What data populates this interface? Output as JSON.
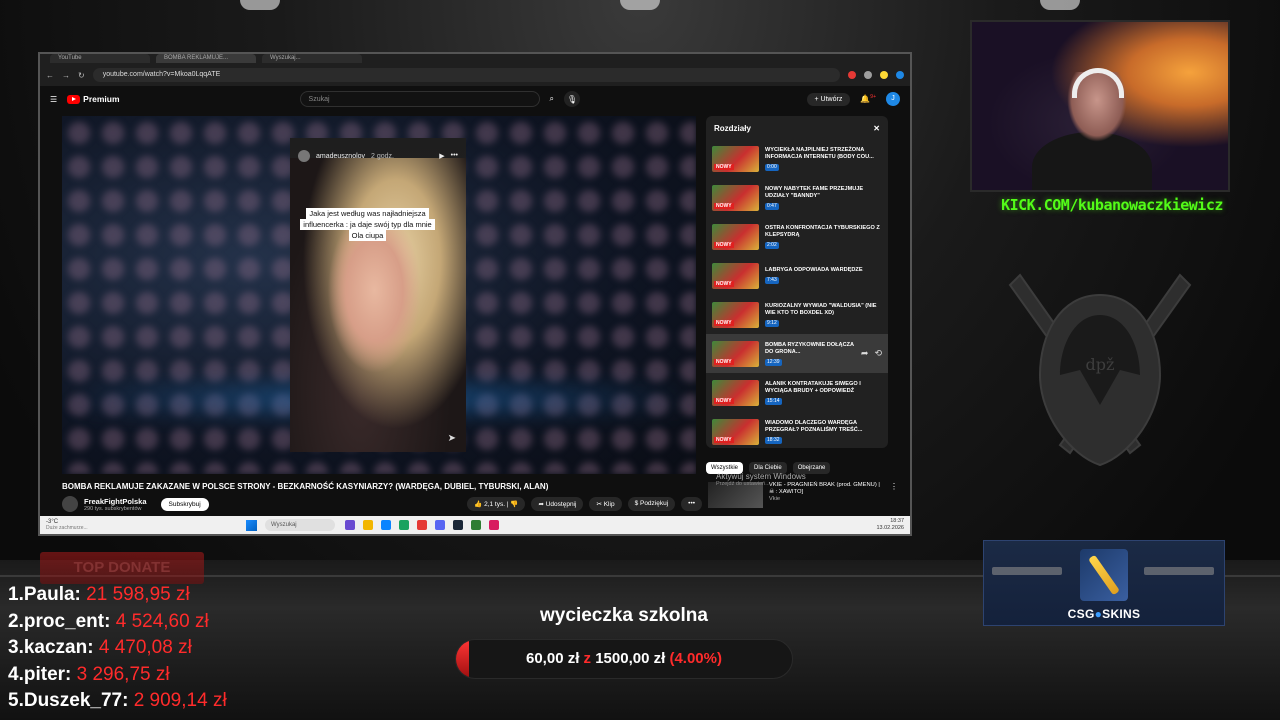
{
  "browser": {
    "tabs": [
      "YouTube",
      "BOMBA REKLAMUJE...",
      "Wyszukaj..."
    ],
    "url": "youtube.com/watch?v=Mkoa0LqqATE"
  },
  "youtube": {
    "logo": "Premium",
    "search_placeholder": "Szukaj",
    "create_label": "Utwórz",
    "notif_count": "9+",
    "avatar_initial": "J"
  },
  "instagram": {
    "username": "amadeusznolov",
    "time": "2 godz.",
    "caption": "Jaka jest według was najładniejsza influencerka : ja daje swój typ dla mnie Ola ciupa"
  },
  "chapters": {
    "title": "Rozdziały",
    "items": [
      {
        "title": "WYCIEKŁA NAJPILNIEJ STRZEŻONA INFORMACJA INTERNETU (BODY COU...",
        "time": "0:00"
      },
      {
        "title": "NOWY NABYTEK FAME PRZEJMUJE UDZIAŁY \"BANNDY\"",
        "time": "0:47"
      },
      {
        "title": "OSTRA KONFRONTACJA TYBURSKIEGO Z KLEPSYDRĄ",
        "time": "2:02"
      },
      {
        "title": "LABRYGA ODPOWIADA WARDĘDZE",
        "time": "7:43"
      },
      {
        "title": "KURIOZALNY WYWIAD \"WALDUSIA\" (NIE WIE KTO TO BOXDEL XD)",
        "time": "9:12"
      },
      {
        "title": "BOMBA RYZYKOWNIE DOŁĄCZA DO GRONA...",
        "time": "12:39"
      },
      {
        "title": "ALANIK KONTRATAKUJE SIWEGO I WYCIĄGA BRUDY + ODPOWIEDŹ",
        "time": "15:14"
      },
      {
        "title": "WIADOMO DLACZEGO WARDĘGA PRZEGRAŁ? POZNALIŚMY TREŚĆ...",
        "time": "18:32"
      }
    ],
    "thumb_badge": "NOWY"
  },
  "filters": [
    "Wszystkie",
    "Dla Ciebie",
    "Obejrzane"
  ],
  "windows_activate": {
    "title": "Aktywuj system Windows",
    "sub": "Przejdź do ustawień..."
  },
  "next_video": {
    "title": "VKIE - PRAGNIEŃ BRAK (prod. GMENU) | ☠ : XAWITO]",
    "channel": "Vkie"
  },
  "video": {
    "title": "BOMBA REKLAMUJE ZAKAZANE W POLSCE STRONY - BEZKARNOŚĆ KASYNIARZY? (WARDĘGA, DUBIEL, TYBURSKI, ALAN)",
    "channel": "FreakFightPolska",
    "subs": "290 tys. subskrybentów",
    "subscribe": "Subskrybuj",
    "likes": "2,1 tys.",
    "share": "Udostępnij",
    "clip": "Klip",
    "thanks": "Podziękuj"
  },
  "taskbar": {
    "weather": "-3°C",
    "weather_sub": "Duże zachmurze...",
    "search": "Wyszukaj",
    "time": "18:37",
    "date": "13.02.2026"
  },
  "stream": {
    "kick_url": "KICK.COM/kubanowaczkiewicz",
    "top_donate_label": "TOP DONATE",
    "donors": [
      {
        "rank": "1.",
        "name": "Paula:",
        "amount": "21 598,95 zł"
      },
      {
        "rank": "2.",
        "name": "proc_ent:",
        "amount": "4 524,60 zł"
      },
      {
        "rank": "3.",
        "name": "kaczan:",
        "amount": "4 470,08 zł"
      },
      {
        "rank": "4.",
        "name": "piter:",
        "amount": "3 296,75 zł"
      },
      {
        "rank": "5.",
        "name": "Duszek_77:",
        "amount": "2 909,14 zł"
      }
    ],
    "goal": {
      "title": "wycieczka szkolna",
      "current": "60,00 zł",
      "separator": "z",
      "target": "1500,00 zł",
      "percent_label": "(4.00%)",
      "progress_fraction": 0.04
    },
    "sponsor": {
      "brand_a": "CSG",
      "brand_b": "SKINS"
    }
  },
  "colors": {
    "kick_green": "#53fc18",
    "donate_red": "#ff2b2b",
    "yt_red": "#ff0000",
    "chapter_ts_blue": "#1565c0"
  }
}
